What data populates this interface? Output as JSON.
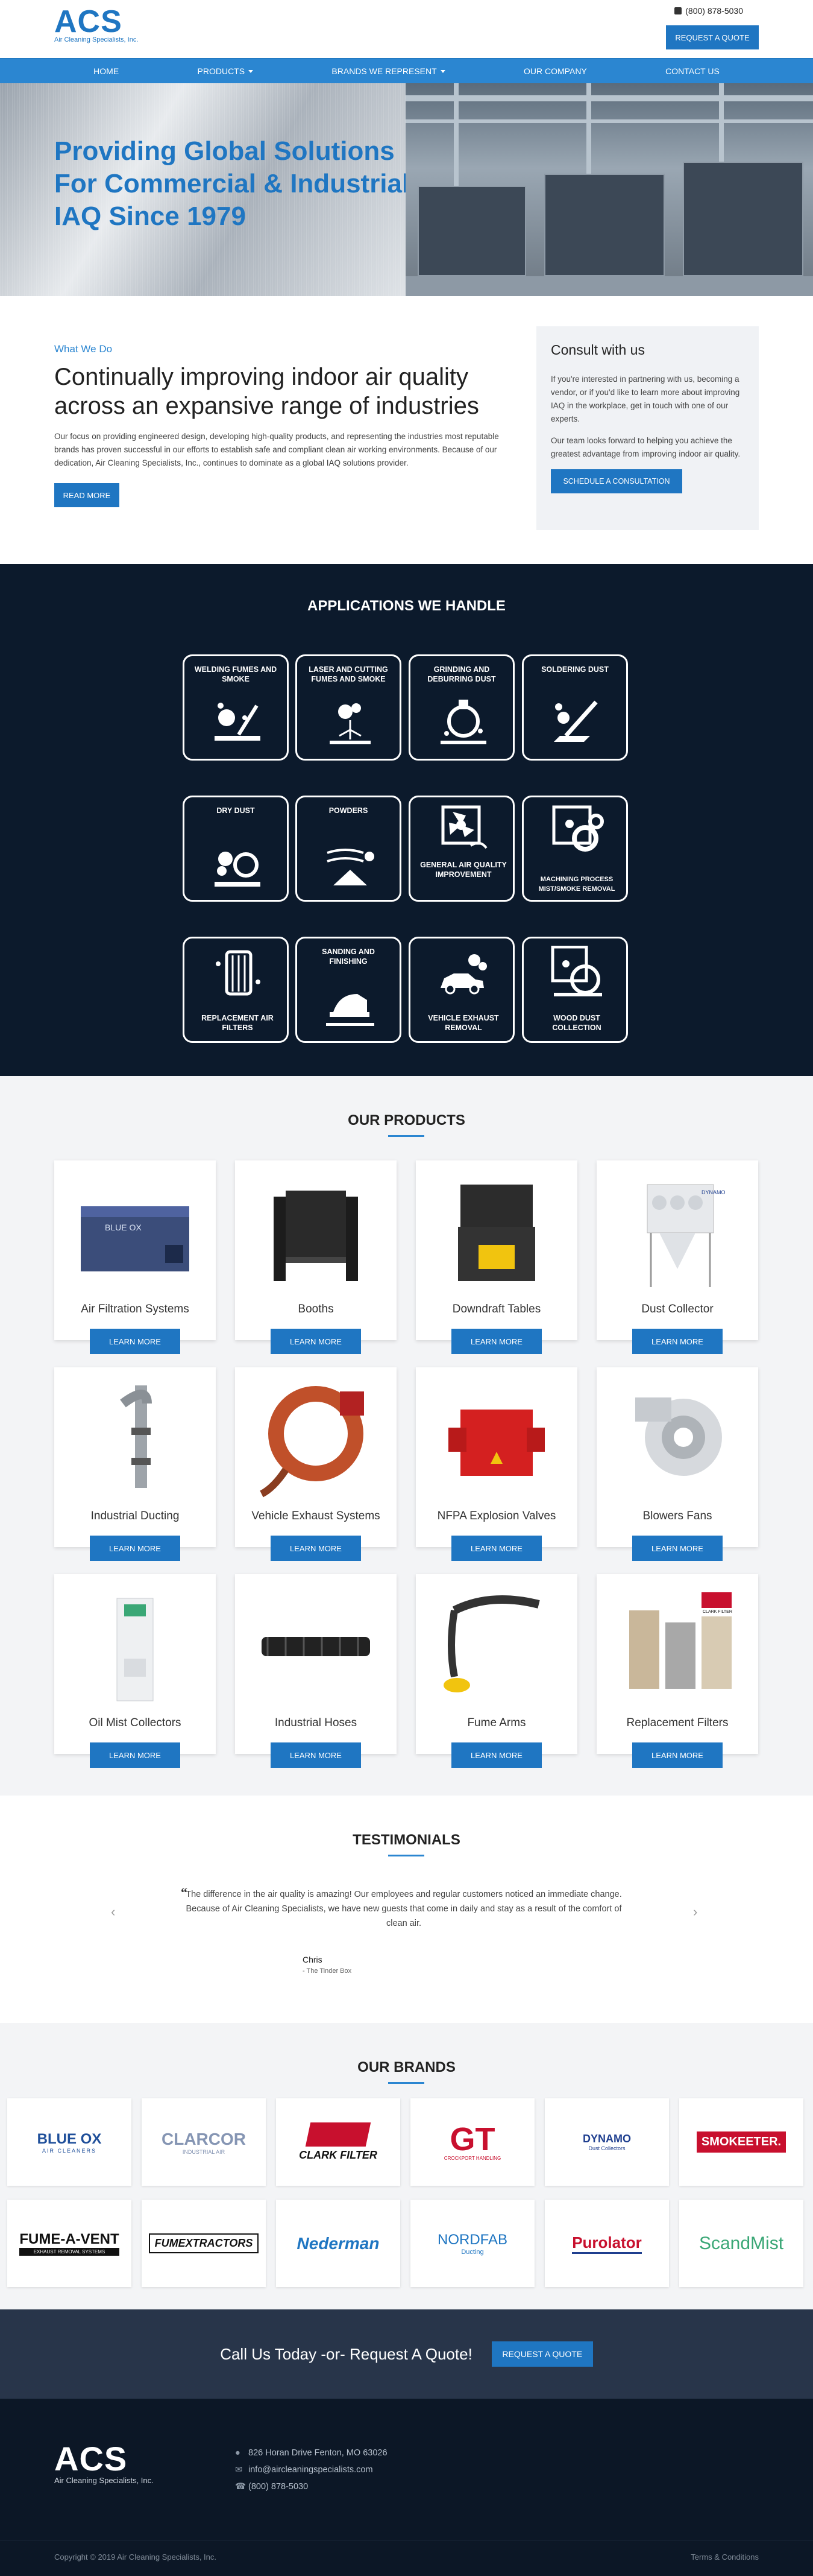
{
  "header": {
    "logo": "ACS",
    "logo_sub": "Air Cleaning Specialists, Inc.",
    "phone": "(800) 878-5030",
    "quote_button": "REQUEST A QUOTE"
  },
  "nav": {
    "items": [
      {
        "label": "HOME",
        "dropdown": false
      },
      {
        "label": "PRODUCTS",
        "dropdown": true
      },
      {
        "label": "BRANDS WE REPRESENT",
        "dropdown": true
      },
      {
        "label": "OUR COMPANY",
        "dropdown": false
      },
      {
        "label": "CONTACT US",
        "dropdown": false
      }
    ]
  },
  "hero": {
    "title": "Providing Global Solutions For Commercial & Industrial IAQ Since 1979"
  },
  "intro": {
    "eyebrow": "What We Do",
    "heading": "Continually improving indoor air quality across an expansive range of industries",
    "paragraph": "Our focus on providing engineered design, developing high-quality products, and representing the industries most reputable brands has proven successful in our efforts to establish safe and compliant clean air working environments. Because of our dedication, Air Cleaning Specialists, Inc., continues to dominate as a global IAQ solutions provider.",
    "read_more": "READ MORE"
  },
  "consult": {
    "title": "Consult with us",
    "p1": "If you're interested in partnering with us, becoming a vendor, or if you'd like to learn more about improving IAQ in the workplace, get in touch with one of our experts.",
    "p2": "Our team looks forward to helping you achieve the greatest advantage from improving indoor air quality.",
    "button": "SCHEDULE A CONSULTATION"
  },
  "applications": {
    "title": "APPLICATIONS WE HANDLE",
    "tiles": [
      {
        "label": "WELDING FUMES AND SMOKE",
        "icon": "welding-icon"
      },
      {
        "label": "LASER AND CUTTING FUMES AND SMOKE",
        "icon": "laser-cutting-icon"
      },
      {
        "label": "GRINDING AND DEBURRING DUST",
        "icon": "grinding-icon"
      },
      {
        "label": "SOLDERING DUST",
        "icon": "soldering-icon"
      },
      {
        "label": "DRY DUST",
        "icon": "dry-dust-icon"
      },
      {
        "label": "POWDERS",
        "icon": "powders-icon"
      },
      {
        "label": "GENERAL AIR QUALITY IMPROVEMENT",
        "icon": "fan-icon"
      },
      {
        "label": "MACHINING PROCESS MIST/SMOKE REMOVAL",
        "icon": "gears-icon"
      },
      {
        "label": "REPLACEMENT AIR FILTERS",
        "icon": "filter-icon"
      },
      {
        "label": "SANDING AND FINISHING",
        "icon": "sander-icon"
      },
      {
        "label": "VEHICLE EXHAUST REMOVAL",
        "icon": "car-icon"
      },
      {
        "label": "WOOD DUST COLLECTION",
        "icon": "saw-icon"
      }
    ]
  },
  "products": {
    "title": "OUR PRODUCTS",
    "learn_more": "LEARN MORE",
    "items": [
      {
        "name": "Air Filtration Systems",
        "image_text": "BLUE OX"
      },
      {
        "name": "Booths"
      },
      {
        "name": "Downdraft Tables"
      },
      {
        "name": "Dust Collector",
        "image_text": "DYNAMO"
      },
      {
        "name": "Industrial Ducting"
      },
      {
        "name": "Vehicle Exhaust Systems"
      },
      {
        "name": "NFPA Explosion Valves"
      },
      {
        "name": "Blowers Fans"
      },
      {
        "name": "Oil Mist Collectors"
      },
      {
        "name": "Industrial Hoses"
      },
      {
        "name": "Fume Arms"
      },
      {
        "name": "Replacement Filters",
        "image_text": "CLARK FILTER"
      }
    ]
  },
  "testimonials": {
    "title": "TESTIMONIALS",
    "quote": "The difference in the air quality is amazing! Our employees and regular customers noticed an immediate change. Because of Air Cleaning Specialists, we have new guests that come in daily and stay as a result of the comfort of clean air.",
    "author": "Chris",
    "company": "- The Tinder Box"
  },
  "brands": {
    "title": "OUR BRANDS",
    "items": [
      {
        "name": "BLUE OX",
        "sub": "AIR CLEANERS",
        "color": "#1f4f9a"
      },
      {
        "name": "CLARCOR",
        "sub": "INDUSTRIAL AIR",
        "color": "#8595b3"
      },
      {
        "name": "CLARK FILTER",
        "sub": "",
        "color": "#c8102e"
      },
      {
        "name": "CROCKPORT HANDLING",
        "sub": "",
        "color": "#c8102e"
      },
      {
        "name": "DYNAMO",
        "sub": "Dust Collectors",
        "color": "#1f3f8f"
      },
      {
        "name": "SMOKEETER.",
        "sub": "",
        "color": "#c8102e"
      },
      {
        "name": "FUME-A-VENT",
        "sub": "EXHAUST REMOVAL SYSTEMS",
        "color": "#111111"
      },
      {
        "name": "FUMEXTRACTORS",
        "sub": "",
        "color": "#111111"
      },
      {
        "name": "Nederman",
        "sub": "",
        "color": "#1f76c2"
      },
      {
        "name": "NORDFAB",
        "sub": "Ducting",
        "color": "#1f76c2"
      },
      {
        "name": "Purolator",
        "sub": "",
        "color": "#c8102e"
      },
      {
        "name": "ScandMist",
        "sub": "",
        "color": "#3aa776"
      }
    ]
  },
  "cta": {
    "text": "Call Us Today -or- Request A Quote!",
    "button": "REQUEST A QUOTE"
  },
  "footer": {
    "logo": "ACS",
    "logo_sub": "Air Cleaning Specialists, Inc.",
    "address": "826 Horan Drive Fenton, MO 63026",
    "email": "info@aircleaningspecialists.com",
    "phone": "(800) 878-5030",
    "copyright": "Copyright © 2019 Air Cleaning Specialists, Inc.",
    "terms": "Terms & Conditions"
  }
}
